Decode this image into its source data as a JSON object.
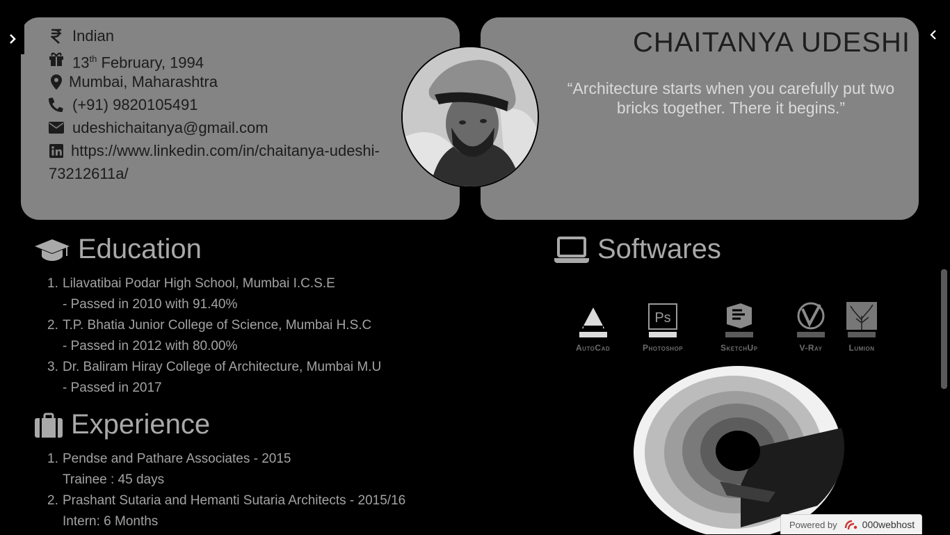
{
  "info": {
    "nationality": "Indian",
    "dob_day": "13",
    "dob_suffix": "th",
    "dob_rest": " February, 1994",
    "location": "Mumbai, Maharashtra",
    "phone": "(+91) 9820105491",
    "email": "udeshichaitanya@gmail.com",
    "linkedin_line1": "https://www.linkedin.com/in/chaitanya-udeshi-",
    "linkedin_line2": "73212611a/"
  },
  "profile": {
    "name": "CHAITANYA UDESHI",
    "quote": "“Architecture starts when you carefully put two bricks together. There it begins.”"
  },
  "education": {
    "title": "Education",
    "items": [
      {
        "num": "1.",
        "line1": "Lilavatibai Podar High School, Mumbai I.C.S.E",
        "line2": "- Passed in 2010 with 91.40%"
      },
      {
        "num": "2.",
        "line1": "T.P. Bhatia Junior College of Science, Mumbai H.S.C",
        "line2": "- Passed in 2012 with 80.00%"
      },
      {
        "num": "3.",
        "line1": "Dr. Baliram Hiray College of Architecture, Mumbai M.U",
        "line2": "- Passed in 2017"
      }
    ]
  },
  "experience": {
    "title": "Experience",
    "items": [
      {
        "num": "1.",
        "line1": "Pendse and Pathare Associates - 2015",
        "line2": "Trainee : 45 days"
      },
      {
        "num": "2.",
        "line1": "Prashant Sutaria and Hemanti Sutaria Architects - 2015/16",
        "line2": "Intern: 6 Months"
      }
    ]
  },
  "softwares": {
    "title": "Softwares",
    "items": [
      {
        "label": "AutoCad",
        "icon": "autocad-icon",
        "active": true
      },
      {
        "label": "Photoshop",
        "icon": "photoshop-icon",
        "active": true
      },
      {
        "label": "SketchUp",
        "icon": "sketchup-icon",
        "active": false
      },
      {
        "label": "V-Ray",
        "icon": "vray-icon",
        "active": false
      },
      {
        "label": "Lumion",
        "icon": "lumion-icon",
        "active": false
      }
    ]
  },
  "footer": {
    "powered_by": "Powered by",
    "brand": "000webhost"
  }
}
